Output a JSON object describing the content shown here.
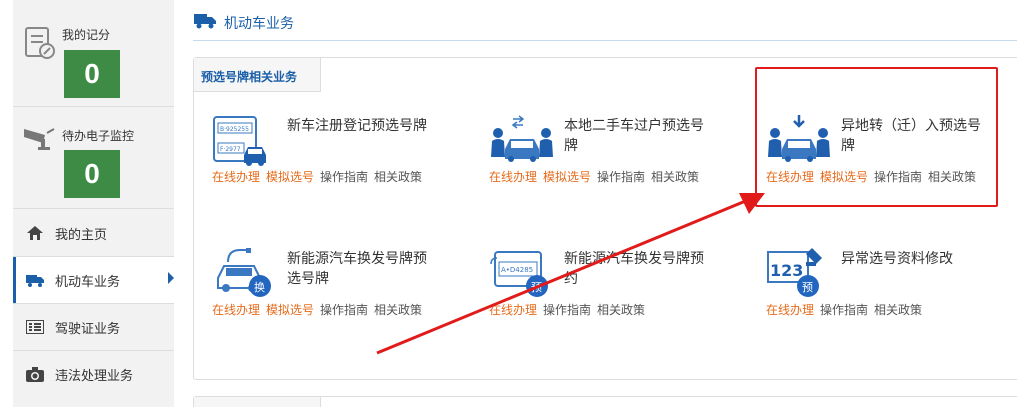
{
  "sidebar": {
    "score_label": "我的记分",
    "score_value": "0",
    "monitor_label": "待办电子监控",
    "monitor_value": "0",
    "nav": [
      {
        "label": "我的主页"
      },
      {
        "label": "机动车业务"
      },
      {
        "label": "驾驶证业务"
      },
      {
        "label": "违法处理业务"
      }
    ]
  },
  "header": {
    "title": "机动车业务"
  },
  "panel": {
    "tab": "预选号牌相关业务"
  },
  "services": [
    {
      "name": "新车注册登记预选号牌",
      "links": [
        "在线办理",
        "模拟选号",
        "操作指南",
        "相关政策"
      ]
    },
    {
      "name": "本地二手车过户预选号牌",
      "links": [
        "在线办理",
        "模拟选号",
        "操作指南",
        "相关政策"
      ]
    },
    {
      "name": "异地转（迁）入预选号牌",
      "links": [
        "在线办理",
        "模拟选号",
        "操作指南",
        "相关政策"
      ]
    },
    {
      "name": "新能源汽车换发号牌预选号牌",
      "links": [
        "在线办理",
        "模拟选号",
        "操作指南",
        "相关政策"
      ],
      "badge": "换"
    },
    {
      "name": "新能源汽车换发号牌预约",
      "links": [
        "在线办理",
        "操作指南",
        "相关政策"
      ],
      "badge": "预"
    },
    {
      "name": "异常选号资料修改",
      "links": [
        "在线办理",
        "操作指南",
        "相关政策"
      ],
      "badge": "预"
    }
  ],
  "icons": {
    "plate_a": "B·925255",
    "plate_b": "F·2977",
    "plate_c": "A•D4285",
    "num": "123"
  },
  "colors": {
    "accent": "#1a5fa7",
    "green": "#3d8b44",
    "orange": "#e66b1c",
    "red": "#e11a1a"
  }
}
